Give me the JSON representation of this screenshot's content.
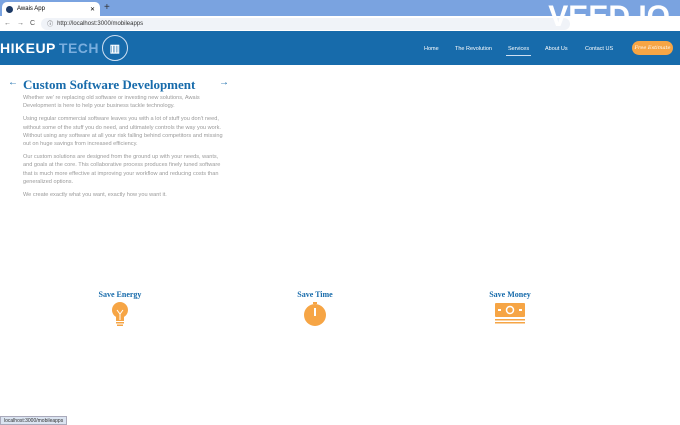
{
  "browser": {
    "tab_title": "Awais App",
    "url": "http://localhost:3000/mobileapps",
    "watermark": "VEED.IO",
    "status_url": "localhost:3000/mobileapps"
  },
  "nav": {
    "logo_a": "HIKEUP",
    "logo_b": "TECH",
    "items": [
      {
        "label": "Home"
      },
      {
        "label": "The Revolution"
      },
      {
        "label": "Services",
        "active": true
      },
      {
        "label": "About Us"
      },
      {
        "label": "Contact US"
      }
    ],
    "cta": "Free Estimate"
  },
  "content": {
    "title": "Custom Software Development",
    "paragraphs": [
      "Whether we' re replacing old software or investing new solutions, Awais Development is here to help your business tackle technology.",
      "Using regular commercial software leaves you with a lot of stuff you don't need, without some of the stuff you do need, and ultimately controls the way you work. Without using any software at all your risk falling behind competitors and missing out on huge savings from increased efficiency.",
      "Our custom solutions are designed from the ground up with your needs, wants, and goals at the core. This collaborative process produces finely tuned software that is much more effective at improving your workflow and reducing costs than generalized options.",
      "We create exactly what you want, exactly how you want it."
    ]
  },
  "features": [
    {
      "label": "Save Energy",
      "icon": "lightbulb-icon"
    },
    {
      "label": "Save Time",
      "icon": "stopwatch-icon"
    },
    {
      "label": "Save Money",
      "icon": "money-icon"
    }
  ],
  "colors": {
    "brand": "#176bab",
    "accent": "#f6a545"
  }
}
